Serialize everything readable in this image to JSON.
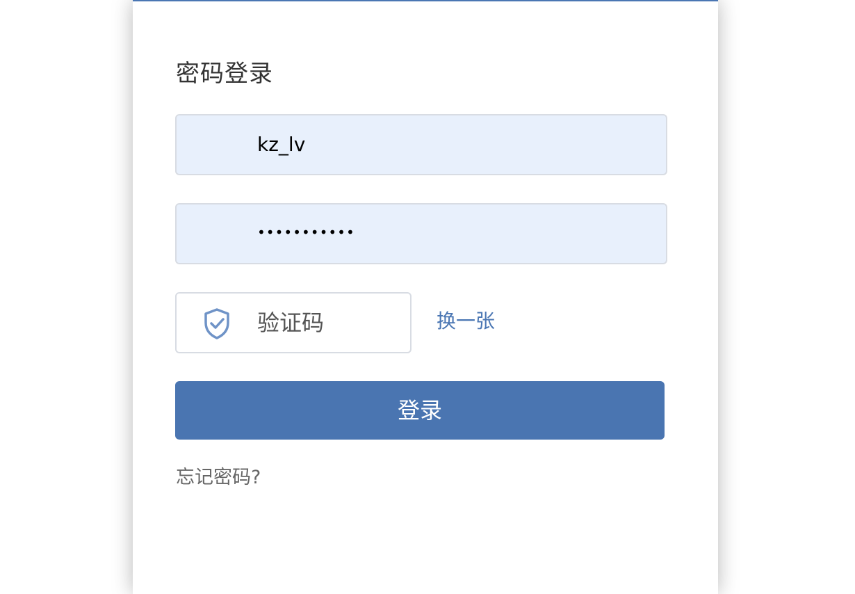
{
  "login": {
    "title": "密码登录",
    "username_value": "kz_lv",
    "password_value": "•••••••••••",
    "captcha_placeholder": "验证码",
    "refresh_label": "换一张",
    "submit_label": "登录",
    "forgot_label": "忘记密码?"
  },
  "colors": {
    "accent": "#4a76b3",
    "autofill_background": "#e8f0fc"
  },
  "icons": {
    "captcha": "shield-check-icon"
  }
}
